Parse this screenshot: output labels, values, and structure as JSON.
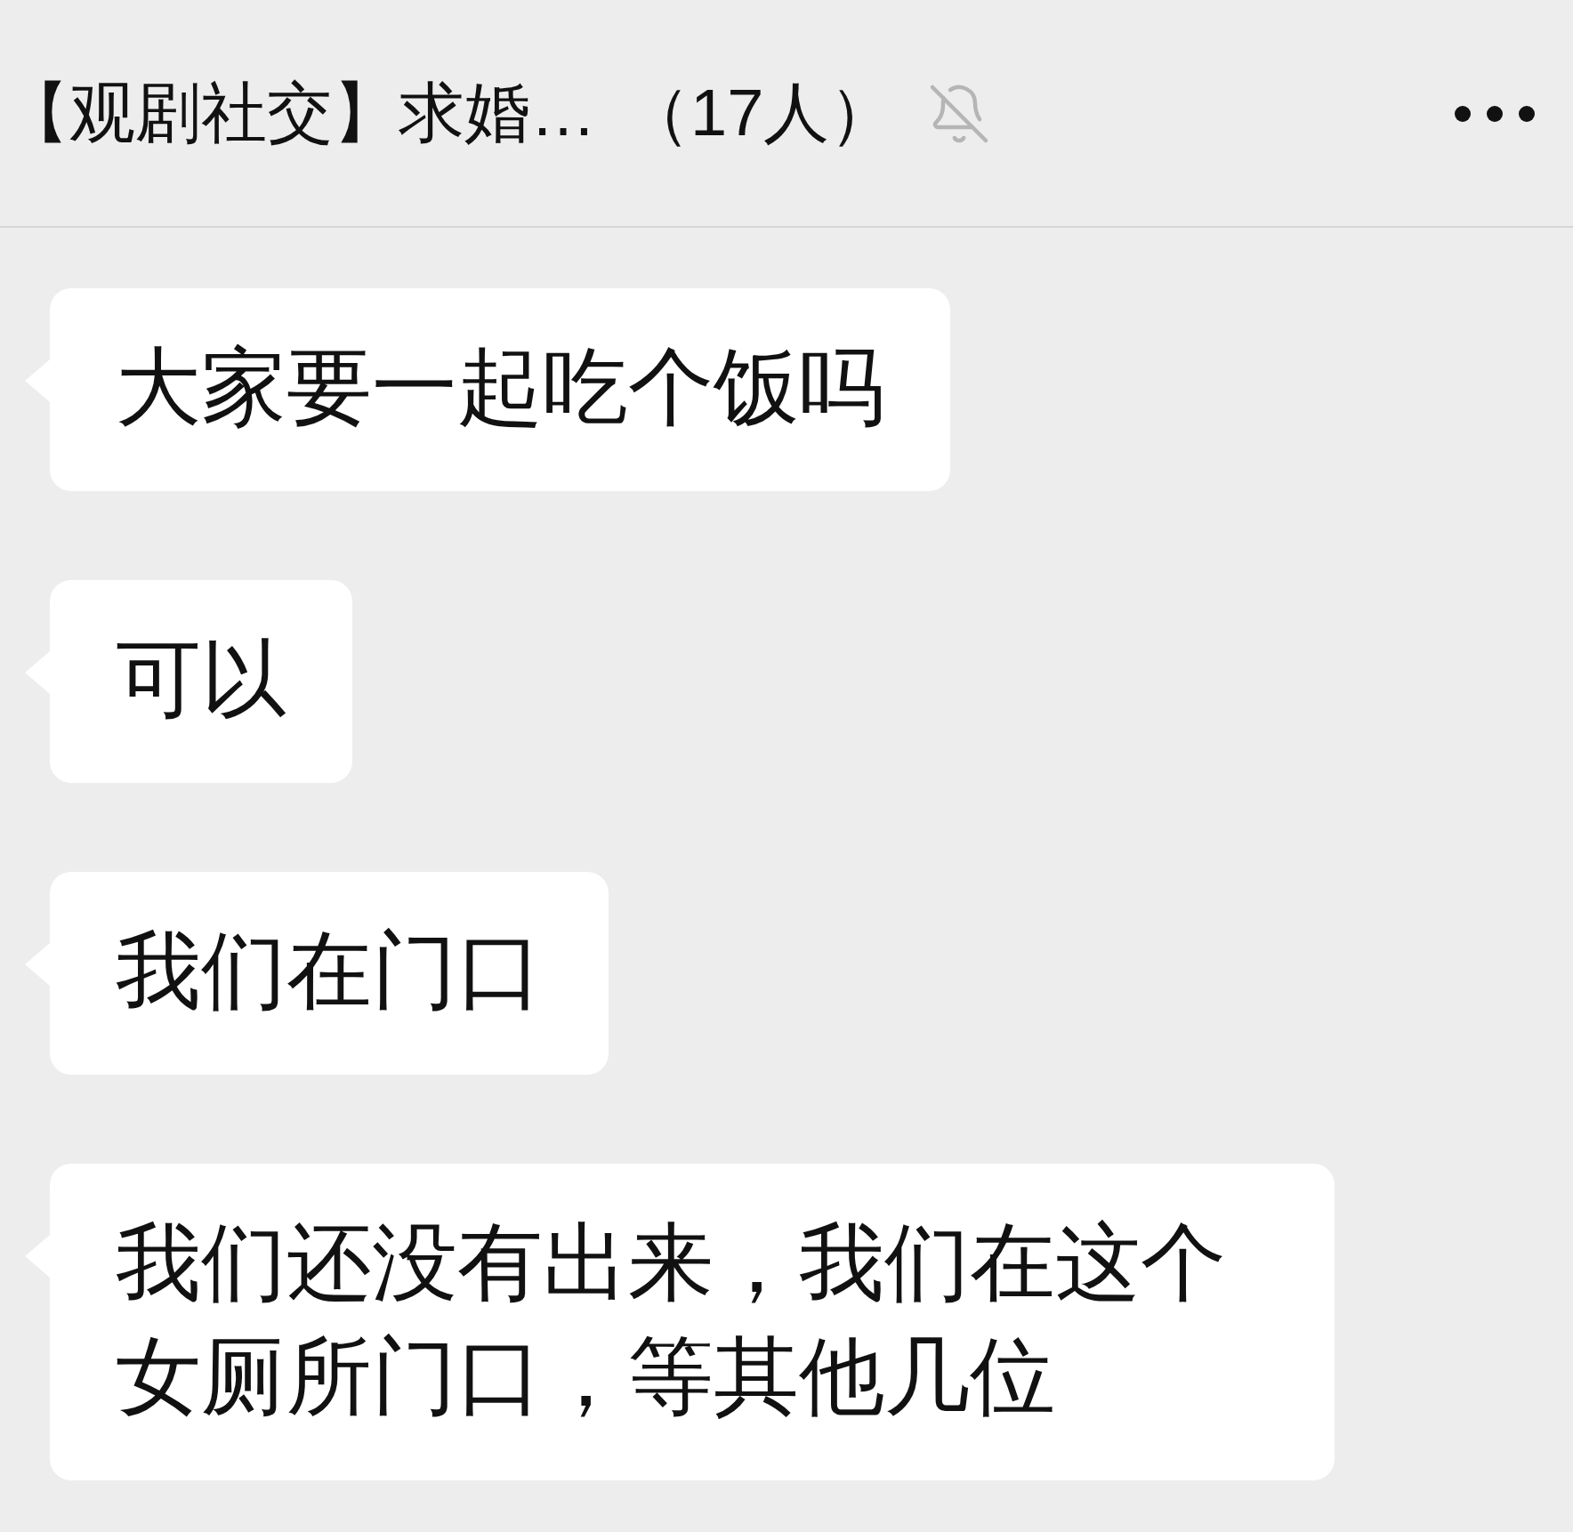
{
  "header": {
    "title": "【观剧社交】求婚…",
    "member_count": "（17人）",
    "muted": true
  },
  "messages": [
    {
      "text": "大家要一起吃个饭吗"
    },
    {
      "text": "可以"
    },
    {
      "text": "我们在门口"
    },
    {
      "text": "我们还没有出来，我们在这个女厕所门口，等其他几位"
    }
  ]
}
